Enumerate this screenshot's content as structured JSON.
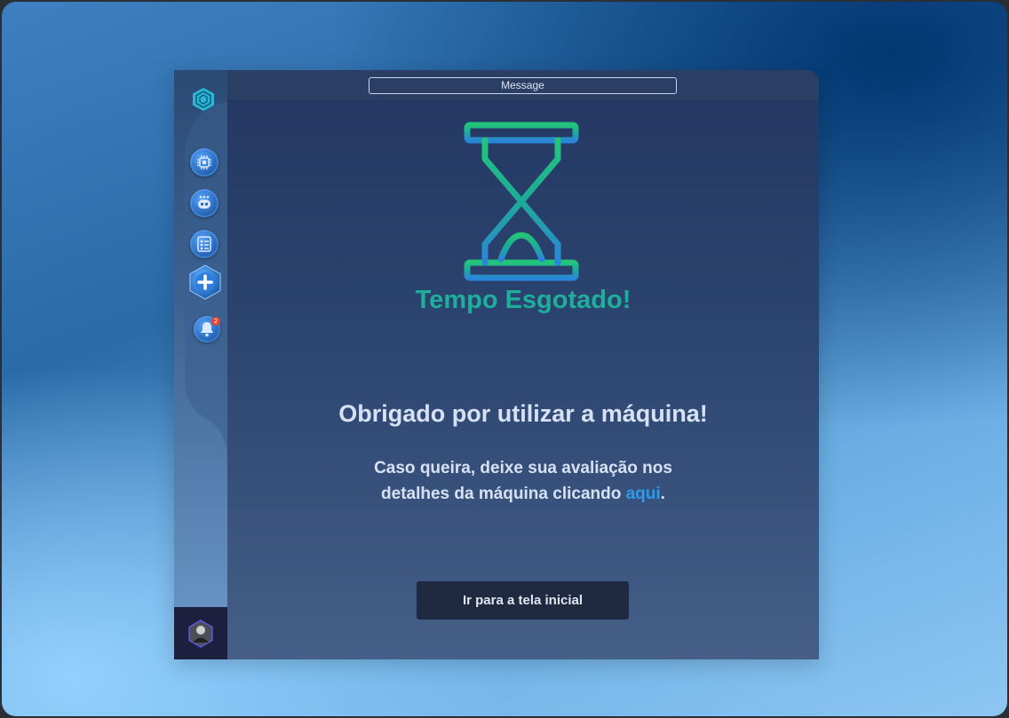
{
  "topbar": {
    "message_label": "Message"
  },
  "sidebar": {
    "items": [
      {
        "name": "chip",
        "icon": "chip-icon"
      },
      {
        "name": "robot",
        "icon": "robot-icon"
      },
      {
        "name": "checklist",
        "icon": "checklist-icon"
      },
      {
        "name": "add",
        "icon": "plus-icon"
      },
      {
        "name": "notifications",
        "icon": "bell-icon",
        "badge": "2"
      }
    ]
  },
  "main": {
    "title": "Tempo Esgotado!",
    "thanks": "Obrigado por utilizar a máquina!",
    "review_line1": "Caso queira, deixe sua avaliação nos",
    "review_line2_prefix": "detalhes da máquina clicando ",
    "review_link": "aqui",
    "review_suffix": ".",
    "home_button": "Ir para a tela inicial"
  },
  "colors": {
    "title_green": "#1fae9a",
    "link_blue": "#2e9ae8",
    "button_dark": "#1f2a41"
  }
}
